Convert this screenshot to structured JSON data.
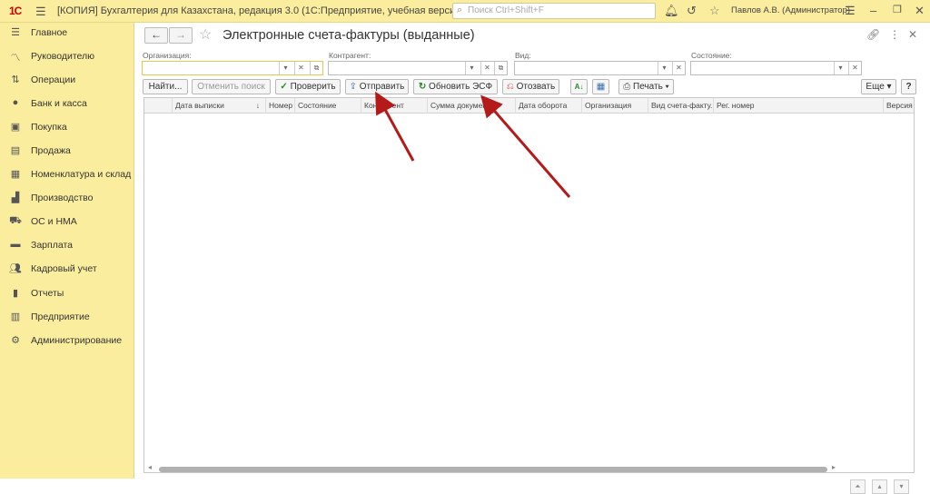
{
  "titlebar": {
    "logo": "1С",
    "title": "[КОПИЯ] Бухгалтерия для Казахстана, редакция 3.0  (1С:Предприятие, учебная версия)",
    "search_placeholder": "Поиск Ctrl+Shift+F",
    "user": "Павлов А.В. (Администратор)"
  },
  "sidebar": {
    "items": [
      {
        "label": "Главное",
        "icon": "menu-icon"
      },
      {
        "label": "Руководителю",
        "icon": "chart-icon"
      },
      {
        "label": "Операции",
        "icon": "operations-icon"
      },
      {
        "label": "Банк и касса",
        "icon": "bank-icon"
      },
      {
        "label": "Покупка",
        "icon": "cart-icon"
      },
      {
        "label": "Продажа",
        "icon": "sale-icon"
      },
      {
        "label": "Номенклатура и склад",
        "icon": "warehouse-icon"
      },
      {
        "label": "Производство",
        "icon": "factory-icon"
      },
      {
        "label": "ОС и НМА",
        "icon": "truck-icon"
      },
      {
        "label": "Зарплата",
        "icon": "salary-icon"
      },
      {
        "label": "Кадровый учет",
        "icon": "people-icon"
      },
      {
        "label": "Отчеты",
        "icon": "reports-icon"
      },
      {
        "label": "Предприятие",
        "icon": "enterprise-icon"
      },
      {
        "label": "Администрирование",
        "icon": "gear-icon"
      }
    ]
  },
  "document": {
    "title": "Электронные счета-фактуры (выданные)"
  },
  "filters": {
    "organization_label": "Организация:",
    "counterparty_label": "Контрагент:",
    "kind_label": "Вид:",
    "state_label": "Состояние:",
    "organization_value": "",
    "counterparty_value": "",
    "kind_value": "",
    "state_value": ""
  },
  "toolbar": {
    "find": "Найти...",
    "cancel_search": "Отменить поиск",
    "check": "Проверить",
    "send": "Отправить",
    "refresh": "Обновить ЭСФ",
    "recall": "Отозвать",
    "print": "Печать",
    "more": "Еще",
    "help": "?"
  },
  "table": {
    "columns": [
      "Дата выписки",
      "Номер",
      "Состояние",
      "Контрагент",
      "Сумма докумен",
      "Дата оборота",
      "Организация",
      "Вид счета-факту...",
      "Рег. номер",
      "Версия"
    ],
    "sort_indicator": "↓",
    "rows": []
  },
  "colors": {
    "sidebar_bg": "#fbed9e",
    "annotation_arrow": "#b51a1a"
  }
}
